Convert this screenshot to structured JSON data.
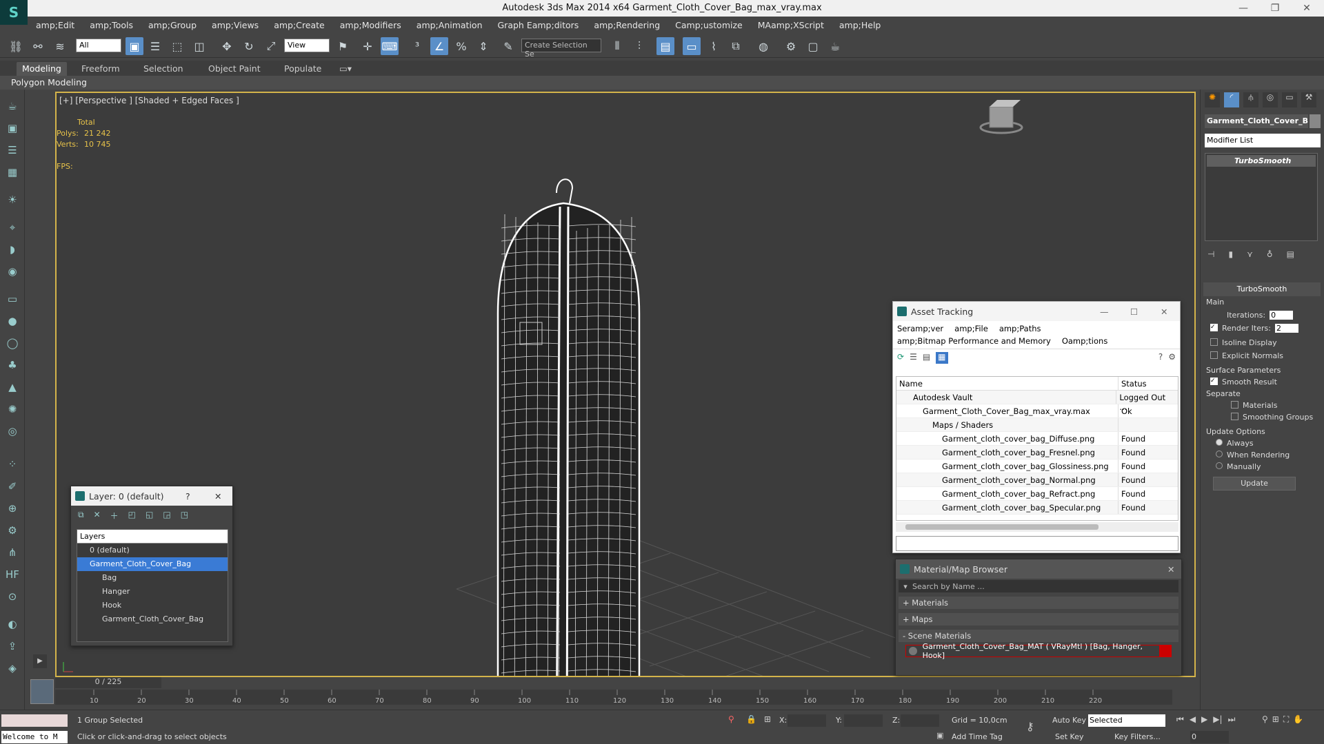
{
  "window": {
    "title": "Autodesk 3ds Max  2014 x64     Garment_Cloth_Cover_Bag_max_vray.max"
  },
  "menubar": [
    "amp;Edit",
    "amp;Tools",
    "amp;Group",
    "amp;Views",
    "amp;Create",
    "amp;Modifiers",
    "amp;Animation",
    "Graph Eamp;ditors",
    "amp;Rendering",
    "Camp;ustomize",
    "MAamp;XScript",
    "amp;Help"
  ],
  "toolbar": {
    "selection_filter": "All",
    "ref_coord": "View",
    "named_selection_placeholder": "Create Selection Se"
  },
  "ribbon": {
    "tabs": [
      "Modeling",
      "Freeform",
      "Selection",
      "Object Paint",
      "Populate"
    ],
    "active": "Modeling",
    "sub_label": "Polygon Modeling"
  },
  "viewport": {
    "label": "[+] [Perspective ] [Shaded + Edged Faces ]",
    "stats_header": "Total",
    "polys_label": "Polys:",
    "polys_value": "21 242",
    "verts_label": "Verts:",
    "verts_value": "10 745",
    "fps_label": "FPS:"
  },
  "command_panel": {
    "object_name": "Garment_Cloth_Cover_B",
    "modifier_list": "Modifier List",
    "modifier_stack": [
      "TurboSmooth"
    ],
    "rollout_title": "TurboSmooth",
    "main_group": "Main",
    "iterations_label": "Iterations:",
    "iterations_value": "0",
    "render_iters_label": "Render Iters:",
    "render_iters_value": "2",
    "render_iters_checked": true,
    "isoline_label": "Isoline Display",
    "explicit_normals_label": "Explicit Normals",
    "surface_params": "Surface Parameters",
    "smooth_result_label": "Smooth Result",
    "separate_label": "Separate",
    "materials_label": "Materials",
    "smoothing_groups_label": "Smoothing Groups",
    "update_options": "Update Options",
    "always_label": "Always",
    "when_rendering_label": "When Rendering",
    "manually_label": "Manually",
    "update_button": "Update"
  },
  "asset_tracking": {
    "title": "Asset Tracking",
    "menu": [
      "Seramp;ver",
      "amp;File",
      "amp;Paths"
    ],
    "menu2": [
      "amp;Bitmap Performance and Memory",
      "Oamp;tions"
    ],
    "columns": [
      "Name",
      "Status"
    ],
    "rows": [
      {
        "name": "Autodesk Vault",
        "status": "Logged Out ...",
        "indent": 0
      },
      {
        "name": "Garment_Cloth_Cover_Bag_max_vray.max",
        "status": "Ok",
        "indent": 1
      },
      {
        "name": "Maps / Shaders",
        "status": "",
        "indent": 2
      },
      {
        "name": "Garment_cloth_cover_bag_Diffuse.png",
        "status": "Found",
        "indent": 3
      },
      {
        "name": "Garment_cloth_cover_bag_Fresnel.png",
        "status": "Found",
        "indent": 3
      },
      {
        "name": "Garment_cloth_cover_bag_Glossiness.png",
        "status": "Found",
        "indent": 3
      },
      {
        "name": "Garment_cloth_cover_bag_Normal.png",
        "status": "Found",
        "indent": 3
      },
      {
        "name": "Garment_cloth_cover_bag_Refract.png",
        "status": "Found",
        "indent": 3
      },
      {
        "name": "Garment_cloth_cover_bag_Specular.png",
        "status": "Found",
        "indent": 3
      }
    ]
  },
  "layer_dialog": {
    "title": "Layer: 0 (default)",
    "help": "?",
    "column": "Layers",
    "items": [
      {
        "name": "0 (default)",
        "indent": 0,
        "selected": false
      },
      {
        "name": "Garment_Cloth_Cover_Bag",
        "indent": 0,
        "selected": true
      },
      {
        "name": "Bag",
        "indent": 1,
        "selected": false
      },
      {
        "name": "Hanger",
        "indent": 1,
        "selected": false
      },
      {
        "name": "Hook",
        "indent": 1,
        "selected": false
      },
      {
        "name": "Garment_Cloth_Cover_Bag",
        "indent": 1,
        "selected": false
      }
    ]
  },
  "material_browser": {
    "title": "Material/Map Browser",
    "search_placeholder": "Search by Name ...",
    "sections": [
      "+ Materials",
      "+ Maps",
      "- Scene Materials"
    ],
    "scene_material": "Garment_Cloth_Cover_Bag_MAT ( VRayMtl ) [Bag, Hanger, Hook]"
  },
  "timeline": {
    "frame_counter": "0 / 225",
    "ticks": [
      "10",
      "20",
      "30",
      "40",
      "50",
      "60",
      "70",
      "80",
      "90",
      "100",
      "110",
      "120",
      "130",
      "140",
      "150",
      "160",
      "170",
      "180",
      "190",
      "200",
      "210",
      "220"
    ]
  },
  "status": {
    "welcome": "Welcome to M",
    "selection_info": "1 Group Selected",
    "prompt": "Click or click-and-drag to select objects",
    "x_label": "X:",
    "y_label": "Y:",
    "z_label": "Z:",
    "grid": "Grid = 10,0cm",
    "auto_key": "Auto Key",
    "set_key": "Set Key",
    "key_mode": "Selected",
    "key_filters": "Key Filters...",
    "add_time_tag": "Add Time Tag",
    "current_frame": "0"
  }
}
